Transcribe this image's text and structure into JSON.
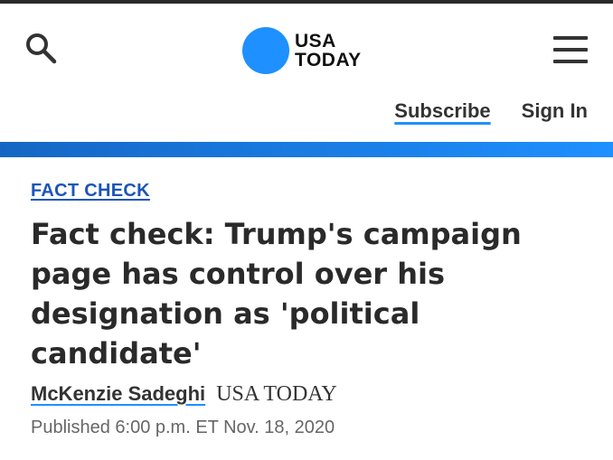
{
  "header": {
    "logo_line1": "USA",
    "logo_line2": "TODAY",
    "search_icon": "search-icon",
    "menu_icon": "hamburger-menu-icon",
    "brand_color": "#1e90ff"
  },
  "account": {
    "subscribe_label": "Subscribe",
    "signin_label": "Sign In"
  },
  "article": {
    "kicker": "FACT CHECK",
    "headline": "Fact check: Trump's campaign page has control over his designation as 'political candidate'",
    "author": "McKenzie Sadeghi",
    "publication": "USA TODAY",
    "published": "Published 6:00 p.m. ET Nov. 18, 2020"
  }
}
